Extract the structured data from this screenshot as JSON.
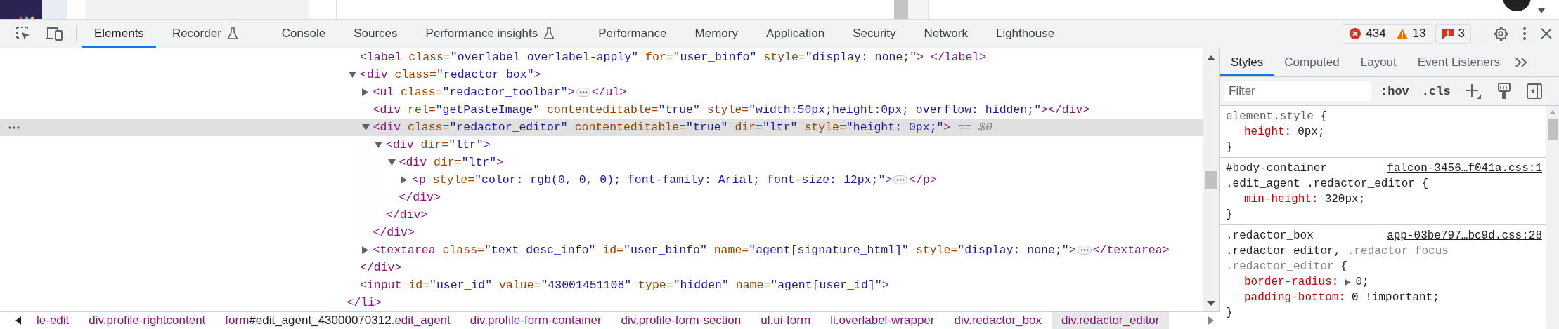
{
  "toolbar": {
    "tabs": [
      {
        "label": "Elements",
        "selected": true,
        "experimental": false
      },
      {
        "label": "Recorder",
        "selected": false,
        "experimental": true
      },
      {
        "label": "Console",
        "selected": false,
        "experimental": false
      },
      {
        "label": "Sources",
        "selected": false,
        "experimental": false
      },
      {
        "label": "Performance insights",
        "selected": false,
        "experimental": true
      },
      {
        "label": "Performance",
        "selected": false,
        "experimental": false
      },
      {
        "label": "Memory",
        "selected": false,
        "experimental": false
      },
      {
        "label": "Application",
        "selected": false,
        "experimental": false
      },
      {
        "label": "Security",
        "selected": false,
        "experimental": false
      },
      {
        "label": "Network",
        "selected": false,
        "experimental": false
      },
      {
        "label": "Lighthouse",
        "selected": false,
        "experimental": false
      }
    ],
    "counters": {
      "errors": "434",
      "warnings": "13",
      "issues": "3"
    }
  },
  "dom_tree": {
    "children": [
      {
        "open": "<label",
        "attrs": [
          {
            "name": " class=",
            "value": "\"overlabel overlabel-apply\""
          },
          {
            "name": " for=",
            "value": "\"user_binfo\""
          },
          {
            "name": " style=",
            "value": "\"display: none;\""
          }
        ],
        "end": "> </label>",
        "selected": false
      },
      {
        "open": "<div",
        "attrs": [
          {
            "name": " class=",
            "value": "\"redactor_box\""
          }
        ],
        "end": ">",
        "expanded": true,
        "selected": false,
        "close": "</div>",
        "children": [
          {
            "open": "<ul",
            "attrs": [
              {
                "name": " class=",
                "value": "\"redactor_toolbar\""
              }
            ],
            "end": ">",
            "expanded": false,
            "selected": false,
            "close": "</ul>"
          },
          {
            "open": "<div",
            "attrs": [
              {
                "name": " rel=",
                "value": "\"getPasteImage\""
              },
              {
                "name": " contenteditable=",
                "value": "\"true\""
              },
              {
                "name": " style=",
                "value": "\"width:50px;height:0px; overflow: hidden;\""
              }
            ],
            "end": "></div>",
            "selected": false
          },
          {
            "open": "<div",
            "attrs": [
              {
                "name": " class=",
                "value": "\"redactor_editor\""
              },
              {
                "name": " contenteditable=",
                "value": "\"true\""
              },
              {
                "name": " dir=",
                "value": "\"ltr\""
              },
              {
                "name": " style=",
                "value": "\"height: 0px;\""
              }
            ],
            "end": ">",
            "marker": "== $0",
            "expanded": true,
            "selected": true,
            "close": "</div>",
            "children": [
              {
                "open": "<div",
                "attrs": [
                  {
                    "name": " dir=",
                    "value": "\"ltr\""
                  }
                ],
                "end": ">",
                "expanded": true,
                "selected": false,
                "close": "</div>",
                "children": [
                  {
                    "open": "<div",
                    "attrs": [
                      {
                        "name": " dir=",
                        "value": "\"ltr\""
                      }
                    ],
                    "end": ">",
                    "expanded": true,
                    "selected": false,
                    "close": "</div>",
                    "children": [
                      {
                        "open": "<p",
                        "attrs": [
                          {
                            "name": " style=",
                            "value": "\"color: rgb(0, 0, 0); font-family: Arial; font-size: 12px;\""
                          }
                        ],
                        "end": ">",
                        "expanded": false,
                        "selected": false,
                        "close": "</p>"
                      }
                    ]
                  }
                ]
              }
            ]
          },
          {
            "open": "<textarea",
            "attrs": [
              {
                "name": " class=",
                "value": "\"text desc_info\""
              },
              {
                "name": " id=",
                "value": "\"user_binfo\""
              },
              {
                "name": " name=",
                "value": "\"agent[signature_html]\""
              },
              {
                "name": " style=",
                "value": "\"display: none;\""
              }
            ],
            "end": ">",
            "expanded": false,
            "selected": false,
            "close": "</textarea>"
          }
        ]
      },
      {
        "open": "<input",
        "attrs": [
          {
            "name": " id=",
            "value": "\"user_id\""
          },
          {
            "name": " value=",
            "value": "\"43001451108\""
          },
          {
            "name": " type=",
            "value": "\"hidden\""
          },
          {
            "name": " name=",
            "value": "\"agent[user_id]\""
          }
        ],
        "end": ">",
        "selected": false
      }
    ],
    "close": "</li>"
  },
  "breadcrumbs": [
    {
      "parts": [
        {
          "kind": "class",
          "text": "le-edit"
        }
      ],
      "selected": false
    },
    {
      "parts": [
        {
          "kind": "tag",
          "text": "div"
        },
        {
          "kind": "class",
          "text": ".profile-rightcontent"
        }
      ],
      "selected": false
    },
    {
      "parts": [
        {
          "kind": "tag",
          "text": "form"
        },
        {
          "kind": "id",
          "text": "#edit_agent_43000070312"
        },
        {
          "kind": "class",
          "text": ".edit_agent"
        }
      ],
      "selected": false
    },
    {
      "parts": [
        {
          "kind": "tag",
          "text": "div"
        },
        {
          "kind": "class",
          "text": ".profile-form-container"
        }
      ],
      "selected": false
    },
    {
      "parts": [
        {
          "kind": "tag",
          "text": "div"
        },
        {
          "kind": "class",
          "text": ".profile-form-section"
        }
      ],
      "selected": false
    },
    {
      "parts": [
        {
          "kind": "tag",
          "text": "ul"
        },
        {
          "kind": "class",
          "text": ".ui-form"
        }
      ],
      "selected": false
    },
    {
      "parts": [
        {
          "kind": "tag",
          "text": "li"
        },
        {
          "kind": "class",
          "text": ".overlabel-wrapper"
        }
      ],
      "selected": false
    },
    {
      "parts": [
        {
          "kind": "tag",
          "text": "div"
        },
        {
          "kind": "class",
          "text": ".redactor_box"
        }
      ],
      "selected": false
    },
    {
      "parts": [
        {
          "kind": "tag",
          "text": "div"
        },
        {
          "kind": "class",
          "text": ".redactor_editor"
        }
      ],
      "selected": true
    }
  ],
  "sidebar": {
    "tabs": [
      {
        "label": "Styles",
        "selected": true
      },
      {
        "label": "Computed",
        "selected": false
      },
      {
        "label": "Layout",
        "selected": false
      },
      {
        "label": "Event Listeners",
        "selected": false
      }
    ],
    "filter": {
      "placeholder": "Filter"
    },
    "hov": ":hov",
    "cls": ".cls",
    "rules": [
      {
        "selector": [
          [
            {
              "kind": "inline",
              "text": "element.style"
            },
            {
              "kind": "punct",
              "text": " {"
            }
          ]
        ],
        "declarations": [
          {
            "kind": "plain",
            "name": "height:",
            "value": "0px;"
          }
        ],
        "close": "}"
      },
      {
        "source": "falcon-3456…f041a.css:1",
        "selector": [
          [
            {
              "kind": "matched",
              "text": "#body-container"
            }
          ],
          [
            {
              "kind": "matched",
              "text": ".edit_agent .redactor_editor"
            },
            {
              "kind": "punct",
              "text": " {"
            }
          ]
        ],
        "declarations": [
          {
            "kind": "plain",
            "name": "min-height:",
            "value": "320px;"
          }
        ],
        "close": "}"
      },
      {
        "source": "app-03be797…bc9d.css:28",
        "selector": [
          [
            {
              "kind": "matched",
              "text": ".redactor_box"
            }
          ],
          [
            {
              "kind": "matched",
              "text": ".redactor_editor"
            },
            {
              "kind": "punct",
              "text": ", "
            },
            {
              "kind": "unmatched",
              "text": ".redactor_focus"
            }
          ],
          [
            {
              "kind": "unmatched",
              "text": ".redactor_editor"
            },
            {
              "kind": "punct",
              "text": " {"
            }
          ]
        ],
        "declarations": [
          {
            "kind": "shorthand",
            "name": "border-radius:",
            "value": "0;",
            "expanded": false
          },
          {
            "kind": "plain",
            "name": "padding-bottom:",
            "value": "0 !important;"
          }
        ],
        "close": "}"
      }
    ]
  }
}
